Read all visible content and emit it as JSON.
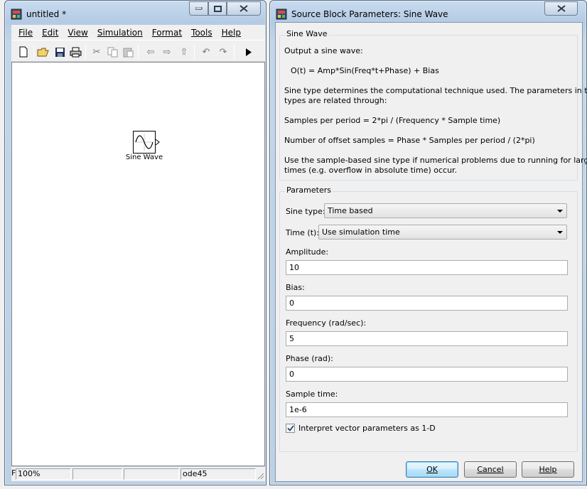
{
  "model_window": {
    "title": "untitled *",
    "menu": [
      "File",
      "Edit",
      "View",
      "Simulation",
      "Format",
      "Tools",
      "Help"
    ],
    "block_label": "Sine Wave",
    "status": {
      "zoom": "100%",
      "solver": "ode45",
      "first": "F"
    }
  },
  "dialog": {
    "title": "Source Block Parameters: Sine Wave",
    "group1_title": "Sine Wave",
    "desc_lines": [
      "Output a sine wave:",
      "O(t) = Amp*Sin(Freq*t+Phase) + Bias",
      "Sine type determines the computational technique used. The parameters in the two",
      "types are related through:",
      "Samples per period = 2*pi / (Frequency * Sample time)",
      "Number of offset samples = Phase * Samples per period / (2*pi)",
      "Use the sample-based sine type if numerical problems due to running for large",
      "times (e.g. overflow in absolute time) occur."
    ],
    "group2_title": "Parameters",
    "sine_type_label": "Sine type:",
    "sine_type_value": "Time based",
    "time_label": "Time (t):",
    "time_value": "Use simulation time",
    "amplitude_label": "Amplitude:",
    "amplitude_value": "10",
    "bias_label": "Bias:",
    "bias_value": "0",
    "frequency_label": "Frequency (rad/sec):",
    "frequency_value": "5",
    "phase_label": "Phase (rad):",
    "phase_value": "0",
    "sample_time_label": "Sample time:",
    "sample_time_value": "1e-6",
    "interpret_label": "Interpret vector parameters as 1-D",
    "interpret_checked": true,
    "buttons": {
      "ok": "OK",
      "cancel": "Cancel",
      "help": "Help"
    }
  }
}
